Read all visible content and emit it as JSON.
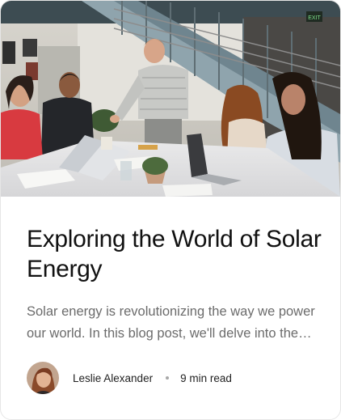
{
  "post": {
    "title": "Exploring the World of Solar Energy",
    "excerpt": "Solar energy is revolutionizing the way we power our world. In this blog post, we'll delve into the benefits, advancements, and future of solar technology.",
    "author": "Leslie Alexander",
    "read_time": "9 min read"
  },
  "hero": {
    "description_icon": "photo-of-team-meeting",
    "exit_sign_text": "EXIT"
  },
  "colors": {
    "title": "#111111",
    "excerpt": "#6b6b6b",
    "border": "#e6e6e6",
    "meta_dot": "#a8a8a8"
  }
}
